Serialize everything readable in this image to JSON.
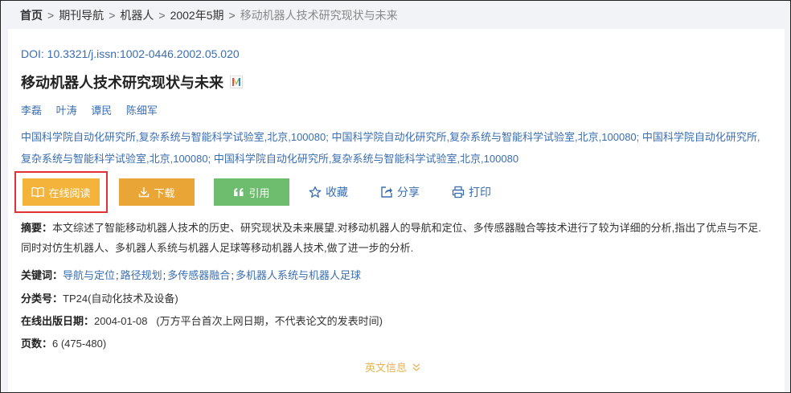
{
  "breadcrumb": {
    "items": [
      "首页",
      "期刊导航",
      "机器人",
      "2002年5期",
      "移动机器人技术研究现状与未来"
    ],
    "separator": ">"
  },
  "article": {
    "doi": "DOI: 10.3321/j.issn:1002-0446.2002.05.020",
    "title": "移动机器人技术研究现状与未来",
    "authors": [
      "李磊",
      "叶涛",
      "谭民",
      "陈细军"
    ],
    "affiliations": "中国科学院自动化研究所,复杂系统与智能科学试验室,北京,100080;  中国科学院自动化研究所,复杂系统与智能科学试验室,北京,100080;  中国科学院自动化研究所,复杂系统与智能科学试验室,北京,100080;  中国科学院自动化研究所,复杂系统与智能科学试验室,北京,100080"
  },
  "actions": {
    "read_online": "在线阅读",
    "download": "下载",
    "cite": "引用",
    "favorite": "收藏",
    "share": "分享",
    "print": "打印"
  },
  "meta": {
    "abstract_label": "摘要：",
    "abstract": "本文综述了智能移动机器人技术的历史、研究现状及未来展望.对移动机器人的导航和定位、多传感器融合等技术进行了较为详细的分析,指出了优点与不足.同时对仿生机器人、多机器人系统与机器人足球等移动机器人技术,做了进一步的分析.",
    "keywords_label": "关键词：",
    "keywords": [
      "导航与定位",
      "路径规划",
      "多传感器融合",
      "多机器人系统与机器人足球"
    ],
    "keyword_separator": ";",
    "clc_label": "分类号：",
    "clc": "TP24(自动化技术及设备)",
    "pubdate_label": "在线出版日期：",
    "pubdate": "2004-01-08   (万方平台首次上网日期，不代表论文的发表时间)",
    "pages_label": "页数：",
    "pages": "6 (475-480)"
  },
  "english_info": "英文信息",
  "colors": {
    "link_blue": "#3a6db0",
    "read_button": "#f4b43c",
    "download_button": "#e9a535",
    "cite_button": "#6ebd6e",
    "highlight_border": "#e03333",
    "english_info": "#e5b45a"
  }
}
